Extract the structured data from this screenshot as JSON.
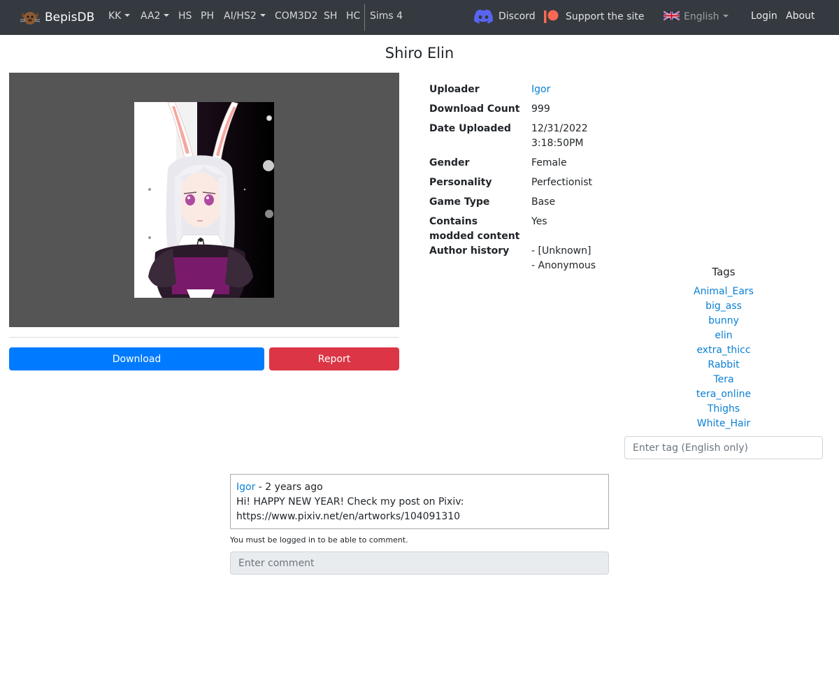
{
  "nav": {
    "brand": "BepisDB",
    "items": [
      {
        "label": "KK",
        "dropdown": true
      },
      {
        "label": "AA2",
        "dropdown": true
      },
      {
        "label": "HS",
        "dropdown": false
      },
      {
        "label": "PH",
        "dropdown": false
      },
      {
        "label": "AI/HS2",
        "dropdown": true
      },
      {
        "label": "COM3D2",
        "dropdown": false
      },
      {
        "label": "SH",
        "dropdown": false
      },
      {
        "label": "HC",
        "dropdown": false
      },
      {
        "label": "Sims 4",
        "dropdown": false
      }
    ],
    "discord": "Discord",
    "support": "Support the site",
    "language": "English",
    "login": "Login",
    "about": "About"
  },
  "card": {
    "title": "Shiro Elin",
    "download_label": "Download",
    "report_label": "Report",
    "info": {
      "uploader_label": "Uploader",
      "uploader_value": "Igor",
      "downloads_label": "Download Count",
      "downloads_value": "999",
      "date_label": "Date Uploaded",
      "date_value_date": "12/31/2022",
      "date_value_time": "3:18:50PM",
      "gender_label": "Gender",
      "gender_value": "Female",
      "personality_label": "Personality",
      "personality_value": "Perfectionist",
      "gametype_label": "Game Type",
      "gametype_value": "Base",
      "modded_label_1": "Contains",
      "modded_label_2": "modded content",
      "modded_value": "Yes",
      "author_label": "Author history",
      "author_value_1": "- [Unknown]",
      "author_value_2": "- Anonymous"
    }
  },
  "tags": {
    "heading": "Tags",
    "items": [
      "Animal_Ears",
      "big_ass",
      "bunny",
      "elin",
      "extra_thicc",
      "Rabbit",
      "Tera",
      "tera_online",
      "Thighs",
      "White_Hair"
    ],
    "input_placeholder": "Enter tag (English only)"
  },
  "comments": {
    "items": [
      {
        "author": "Igor",
        "time": " - 2 years ago",
        "line1": "Hi! HAPPY NEW YEAR! Check my post on Pixiv:",
        "line2": "https://www.pixiv.net/en/artworks/104091310"
      }
    ],
    "login_note": "You must be logged in to be able to comment.",
    "input_placeholder": "Enter comment"
  },
  "colors": {
    "navbar": "#343a40",
    "primary": "#007bff",
    "danger": "#dc3545",
    "link": "#0a7fd4",
    "discord": "#5865f2",
    "patreon": "#f96854"
  }
}
